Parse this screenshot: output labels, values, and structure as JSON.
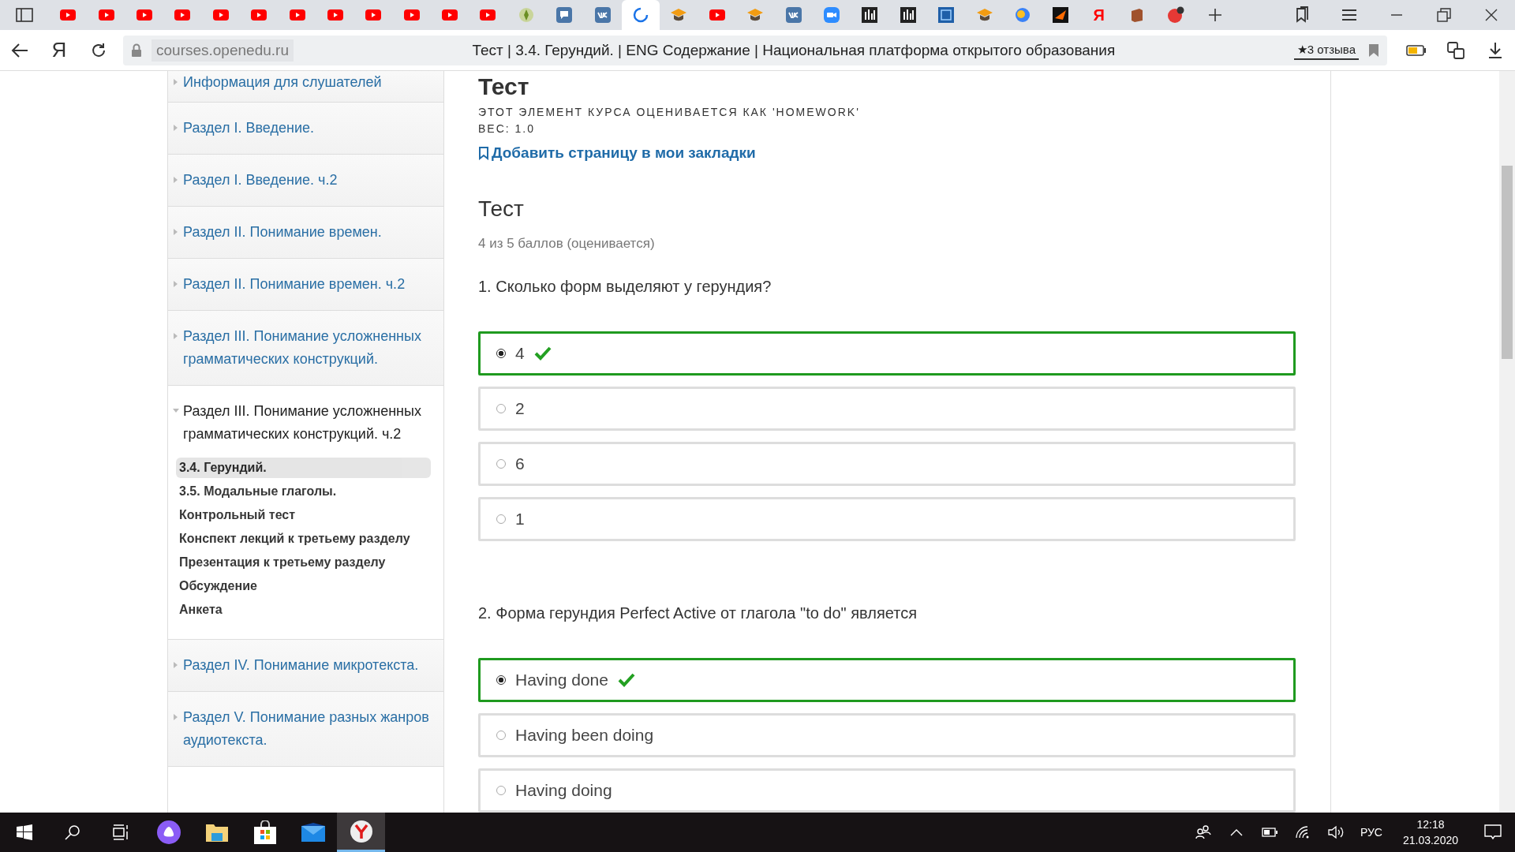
{
  "tabs": [
    {
      "kind": "youtube",
      "selected": false
    },
    {
      "kind": "youtube",
      "selected": false
    },
    {
      "kind": "youtube",
      "selected": false
    },
    {
      "kind": "youtube",
      "selected": false
    },
    {
      "kind": "youtube",
      "selected": false
    },
    {
      "kind": "youtube",
      "selected": false
    },
    {
      "kind": "youtube",
      "selected": false
    },
    {
      "kind": "youtube",
      "selected": false
    },
    {
      "kind": "youtube",
      "selected": false
    },
    {
      "kind": "youtube",
      "selected": false
    },
    {
      "kind": "youtube",
      "selected": false
    },
    {
      "kind": "youtube",
      "selected": false
    },
    {
      "kind": "emblem",
      "selected": false
    },
    {
      "kind": "chat",
      "selected": false
    },
    {
      "kind": "square",
      "selected": false
    },
    {
      "kind": "loading",
      "selected": true
    },
    {
      "kind": "cap",
      "selected": false
    },
    {
      "kind": "youtube",
      "selected": false
    },
    {
      "kind": "cap",
      "selected": false
    },
    {
      "kind": "square",
      "selected": false
    },
    {
      "kind": "camera",
      "selected": false
    },
    {
      "kind": "chart",
      "selected": false
    },
    {
      "kind": "chart",
      "selected": false
    },
    {
      "kind": "book",
      "selected": false
    },
    {
      "kind": "cap",
      "selected": false
    },
    {
      "kind": "blob",
      "selected": false
    },
    {
      "kind": "arrow",
      "selected": false
    },
    {
      "kind": "letter",
      "text": "Я",
      "selected": false
    },
    {
      "kind": "brownbook",
      "selected": false
    },
    {
      "kind": "badge",
      "selected": false
    }
  ],
  "address_bar": {
    "home": "Я",
    "site": "courses.openedu.ru",
    "title": "Тест | 3.4. Герундий. | ENG Содержание | Национальная платформа открытого образования",
    "reviews": "★3 отзыва"
  },
  "sidebar": {
    "sections": [
      {
        "title": "Информация для слушателей",
        "expanded": false
      },
      {
        "title": "Раздел I. Введение.",
        "expanded": false
      },
      {
        "title": "Раздел I. Введение. ч.2",
        "expanded": false
      },
      {
        "title": "Раздел II. Понимание времен.",
        "expanded": false
      },
      {
        "title": "Раздел II. Понимание времен. ч.2",
        "expanded": false
      },
      {
        "title": "Раздел III. Понимание усложненных грамматических конструкций.",
        "expanded": false
      },
      {
        "title": "Раздел III. Понимание усложненных грамматических конструкций. ч.2",
        "expanded": true,
        "children": [
          {
            "title": "3.4. Герундий.",
            "selected": true
          },
          {
            "title": "3.5. Модальные глаголы.",
            "selected": false
          },
          {
            "title": "Контрольный тест",
            "selected": false
          },
          {
            "title": "Конспект лекций к третьему разделу",
            "selected": false
          },
          {
            "title": "Презентация к третьему разделу",
            "selected": false
          },
          {
            "title": "Обсуждение",
            "selected": false
          },
          {
            "title": "Анкета",
            "selected": false
          }
        ]
      },
      {
        "title": "Раздел IV. Понимание микротекста.",
        "expanded": false
      },
      {
        "title": "Раздел V. Понимание разных жанров аудиотекста.",
        "expanded": false
      }
    ]
  },
  "page": {
    "heading": "Тест",
    "grading_note": "ЭТОТ ЭЛЕМЕНТ КУРСА ОЦЕНИВАЕТСЯ КАК 'HOMEWORK'",
    "weight": "ВЕС: 1.0",
    "bookmark_link": "Добавить страницу в мои закладки",
    "problem_title": "Тест",
    "score": "4 из 5 баллов (оценивается)",
    "questions": [
      {
        "text": "1. Сколько форм выделяют у герундия?",
        "options": [
          {
            "label": "4",
            "selected": true,
            "correct": true
          },
          {
            "label": "2",
            "selected": false,
            "correct": false
          },
          {
            "label": "6",
            "selected": false,
            "correct": false
          },
          {
            "label": "1",
            "selected": false,
            "correct": false
          }
        ]
      },
      {
        "text": "2. Форма герундия Perfect Active от глагола \"to do\" является",
        "options": [
          {
            "label": "Having done",
            "selected": true,
            "correct": true
          },
          {
            "label": "Having been doing",
            "selected": false,
            "correct": false
          },
          {
            "label": "Having doing",
            "selected": false,
            "correct": false
          }
        ]
      }
    ]
  },
  "taskbar": {
    "apps": [
      {
        "kind": "start",
        "selected": false
      },
      {
        "kind": "search",
        "selected": false
      },
      {
        "kind": "taskview",
        "selected": false
      },
      {
        "kind": "assistant",
        "selected": false
      },
      {
        "kind": "folder",
        "selected": false
      },
      {
        "kind": "store",
        "selected": false
      },
      {
        "kind": "mail",
        "selected": false
      },
      {
        "kind": "browser",
        "selected": true
      }
    ],
    "language": "РУС",
    "time": "12:18",
    "date": "21.03.2020"
  }
}
